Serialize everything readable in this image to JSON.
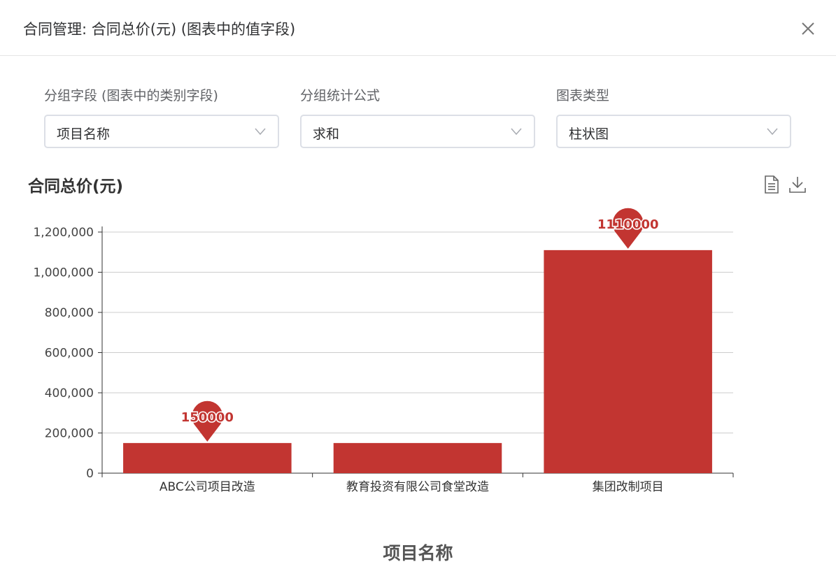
{
  "dialog": {
    "title": "合同管理: 合同总价(元) (图表中的值字段)"
  },
  "filters": [
    {
      "label": "分组字段 (图表中的类别字段)",
      "value": "项目名称"
    },
    {
      "label": "分组统计公式",
      "value": "求和"
    },
    {
      "label": "图表类型",
      "value": "柱状图"
    }
  ],
  "icons": {
    "close": "close-icon",
    "data_view": "data-view-icon",
    "download": "download-icon",
    "caret": "chevron-down-icon"
  },
  "colors": {
    "bar": "#c23531",
    "axis": "#333333",
    "grid": "#cccccc"
  },
  "chart_data": {
    "type": "bar",
    "title": "合同总价(元)",
    "xlabel": "项目名称",
    "ylabel": "",
    "categories": [
      "ABC公司项目改造",
      "教育投资有限公司食堂改造",
      "集团改制项目"
    ],
    "values": [
      150000,
      150000,
      1110000
    ],
    "ylim": [
      0,
      1200000
    ],
    "yticks": [
      "0",
      "200,000",
      "400,000",
      "600,000",
      "800,000",
      "1,000,000",
      "1,200,000"
    ],
    "markers": [
      {
        "category_index": 0,
        "label": "150000"
      },
      {
        "category_index": 2,
        "label": "1110000"
      }
    ],
    "grid": true,
    "legend": "none"
  }
}
